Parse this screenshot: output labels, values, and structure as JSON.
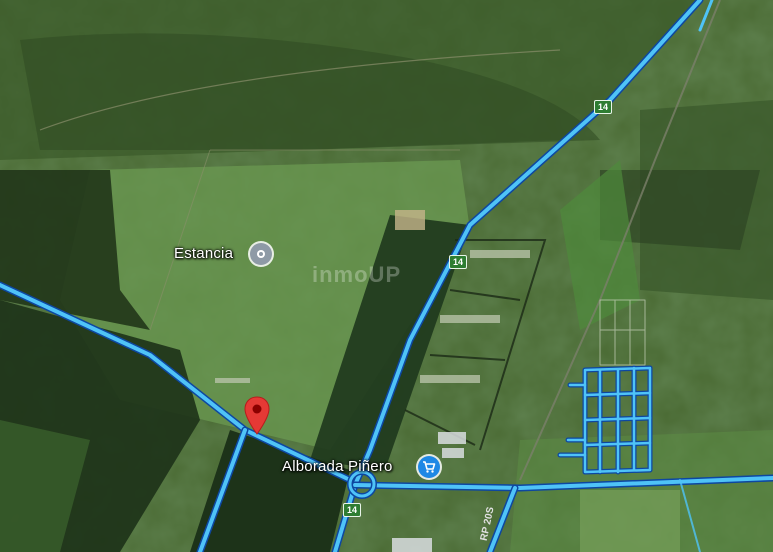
{
  "map": {
    "places": [
      {
        "name": "Estancia",
        "icon": "place-pin-icon"
      },
      {
        "name": "Alborada Piñero",
        "icon": "shopping-cart-icon"
      }
    ],
    "routes": [
      {
        "label": "14",
        "id": "route-14-north"
      },
      {
        "label": "14",
        "id": "route-14-mid"
      },
      {
        "label": "14",
        "id": "route-14-south"
      },
      {
        "label": "RP 20S",
        "id": "route-rp20s"
      }
    ],
    "watermark": "inmoUP",
    "marker": {
      "icon": "location-marker-icon"
    },
    "colors": {
      "road": "#4fc3f7",
      "marker": "#e53935",
      "pin": "#8e9aa6",
      "cart": "#1e88e5"
    }
  }
}
